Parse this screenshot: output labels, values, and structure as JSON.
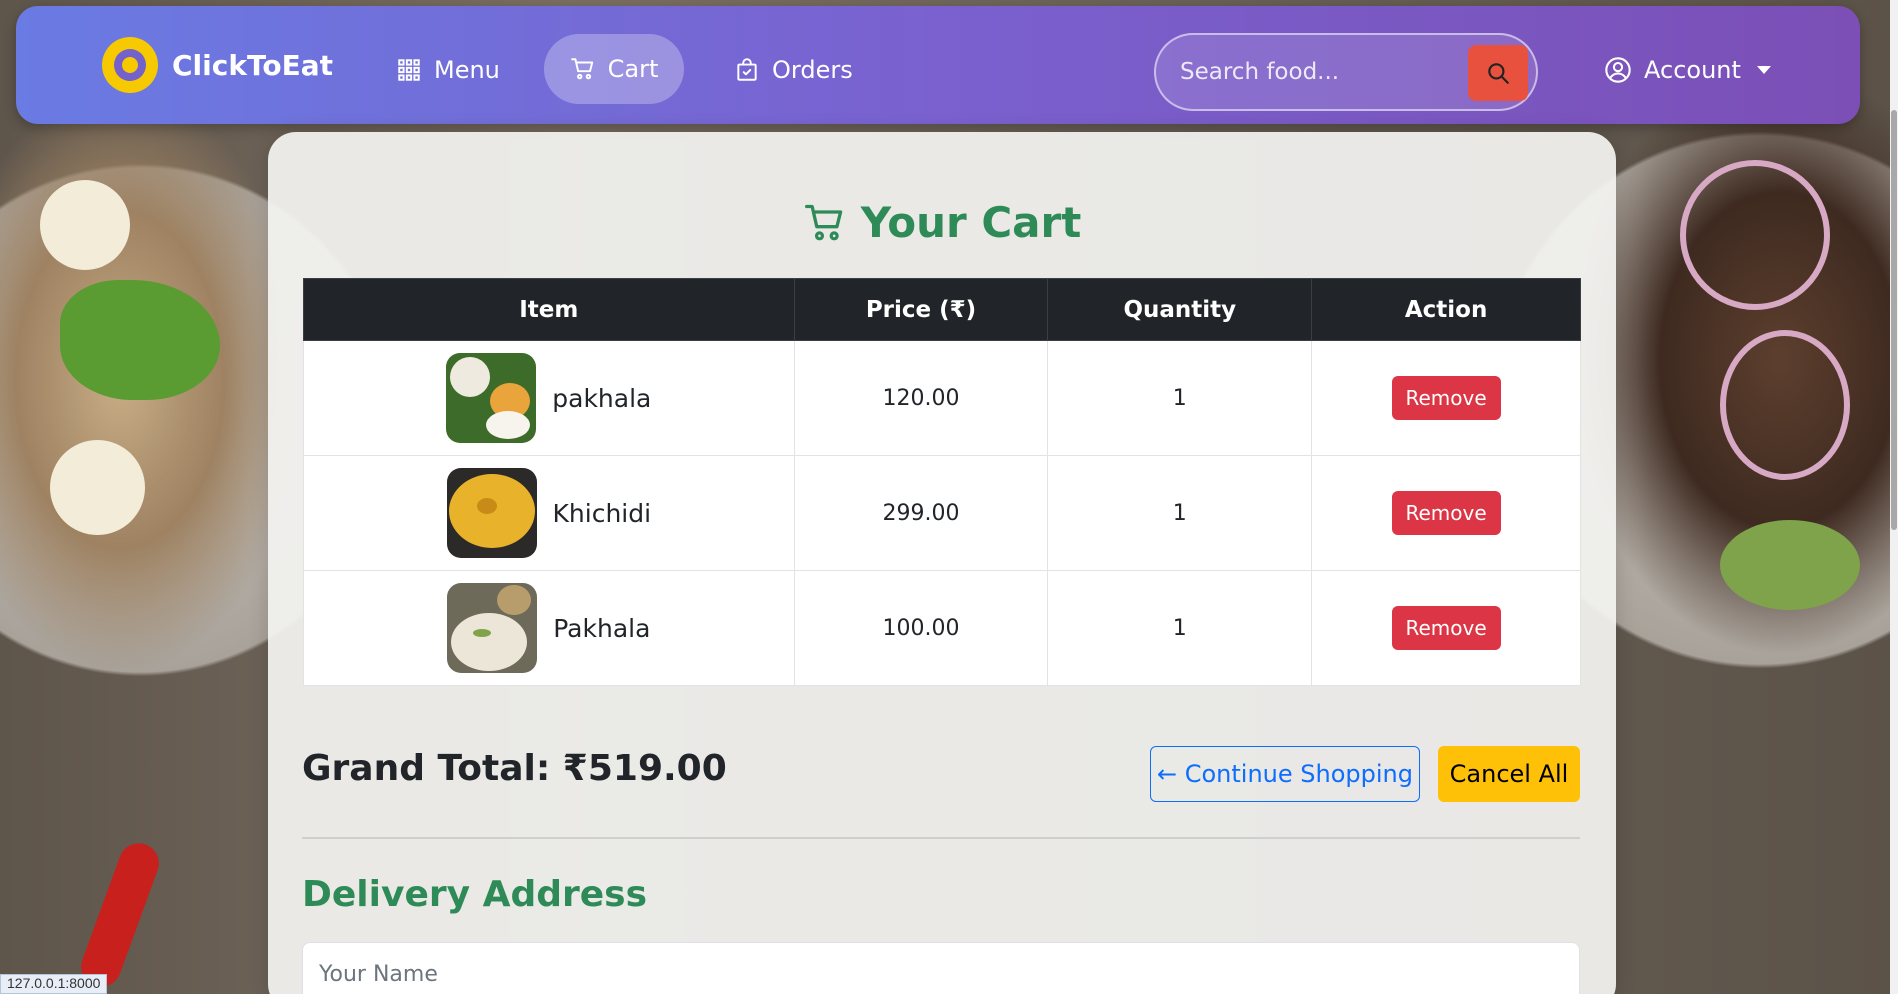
{
  "brand": {
    "name": "ClickToEat"
  },
  "nav": {
    "menu": "Menu",
    "cart": "Cart",
    "orders": "Orders",
    "account": "Account"
  },
  "search": {
    "placeholder": "Search food..."
  },
  "cart": {
    "title": "Your Cart",
    "headers": [
      "Item",
      "Price (₹)",
      "Quantity",
      "Action"
    ],
    "items": [
      {
        "name": "pakhala",
        "price": "120.00",
        "quantity": "1",
        "action": "Remove"
      },
      {
        "name": "Khichidi",
        "price": "299.00",
        "quantity": "1",
        "action": "Remove"
      },
      {
        "name": "Pakhala",
        "price": "100.00",
        "quantity": "1",
        "action": "Remove"
      }
    ],
    "grand_total": "Grand Total: ₹519.00",
    "continue_label": "← Continue Shopping",
    "cancel_label": "Cancel All"
  },
  "delivery": {
    "title": "Delivery Address",
    "name_placeholder": "Your Name"
  },
  "status_url": "127.0.0.1:8000",
  "colors": {
    "accent_green": "#2e8b57",
    "remove_red": "#dc3545",
    "cancel_yellow": "#ffc107",
    "continue_blue": "#0d6efd",
    "search_button": "#e8513d"
  }
}
